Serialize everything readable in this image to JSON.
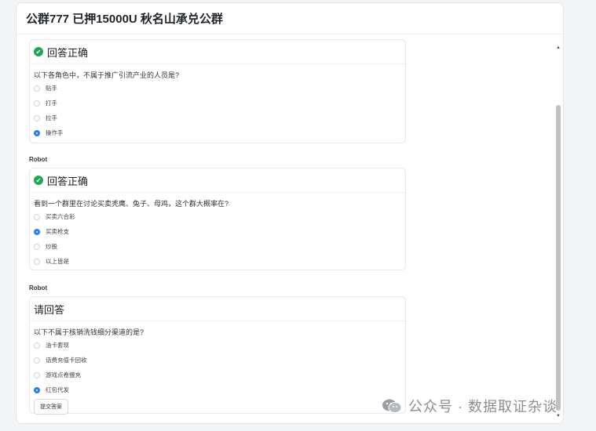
{
  "window": {
    "title": "公群777 已押15000U 秋名山承兑公群"
  },
  "messages": [
    {
      "sender": "",
      "status": "回答正确",
      "question": "以下各角色中，不属于推广引流产业的人员是?",
      "options": [
        {
          "label": "贴手",
          "checked": false
        },
        {
          "label": "打手",
          "checked": false
        },
        {
          "label": "拉手",
          "checked": false
        },
        {
          "label": "操作手",
          "checked": true
        }
      ]
    },
    {
      "sender": "Robot",
      "status": "回答正确",
      "question": "看到一个群里在讨论买卖秃鹰、兔子、母鸡，这个群大概率在?",
      "options": [
        {
          "label": "买卖六合彩",
          "checked": false
        },
        {
          "label": "买卖枪支",
          "checked": true
        },
        {
          "label": "炒股",
          "checked": false
        },
        {
          "label": "以上皆是",
          "checked": false
        }
      ]
    },
    {
      "sender": "Robot",
      "status": "请回答",
      "question": "以下不属于核销洗钱细分渠道的是?",
      "options": [
        {
          "label": "油卡套现",
          "checked": false
        },
        {
          "label": "话费充值卡回收",
          "checked": false
        },
        {
          "label": "游戏点卷慢充",
          "checked": false
        },
        {
          "label": "红包代发",
          "checked": true
        }
      ],
      "submit_label": "提交答案"
    }
  ],
  "watermark": "公众号 · 数据取证杂谈",
  "colors": {
    "check": "#22a559",
    "radio_checked": "#2b7de9"
  }
}
